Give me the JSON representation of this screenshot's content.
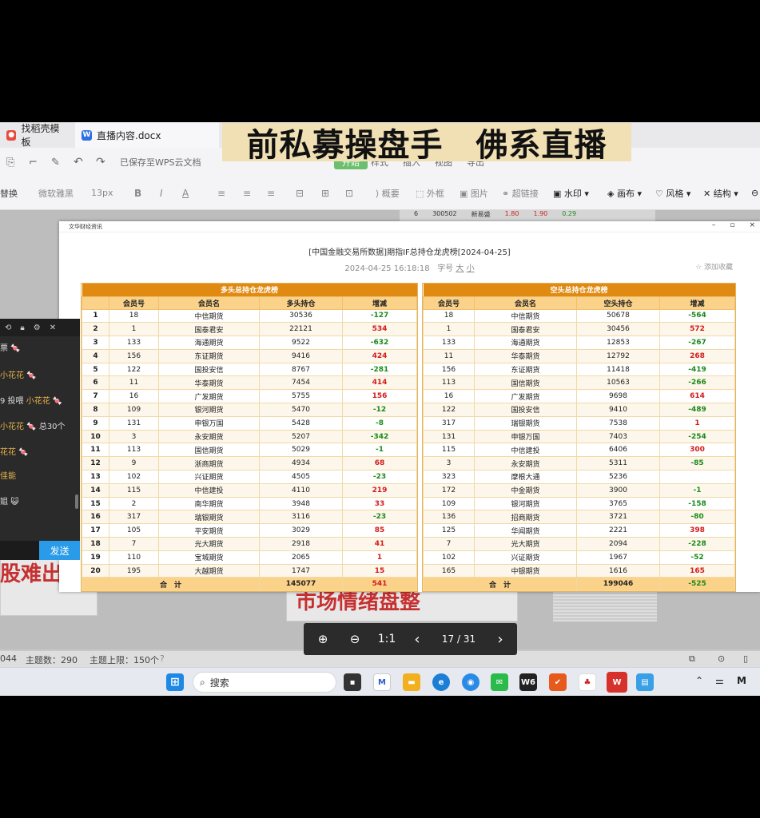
{
  "tabs": [
    {
      "label": "找稻壳模板",
      "icon": "docer-icon"
    },
    {
      "label": "直播内容.docx",
      "icon": "word-doc-icon"
    }
  ],
  "banner": "前私募操盘手　佛系直播",
  "toolbar": {
    "saved": "已保存至WPS云文档",
    "menu": [
      "样式",
      "插入",
      "视图",
      "导出"
    ],
    "replace": "替换",
    "font": "微软雅黑",
    "size": "13px",
    "items": [
      "概要",
      "外框",
      "图片",
      "超链接",
      "水印",
      "画布",
      "风格",
      "结构"
    ]
  },
  "stock_strip": [
    "6",
    "300502",
    "新易盛",
    "1.80",
    "1.90",
    "0.29"
  ],
  "window": {
    "title": "文华财经资讯",
    "ctrl_min": "–",
    "ctrl_max": "▫",
    "ctrl_close": "×",
    "heading": "[中国金融交易所数据]期指IF总持仓龙虎榜[2024-04-25]",
    "datetime": "2024-04-25 16:18:18",
    "font_label": "字号",
    "font_big": "大",
    "font_small": "小",
    "favorite": "☆ 添加收藏"
  },
  "long_table": {
    "caption": "多头总持仓龙虎榜",
    "headers": [
      "",
      "会员号",
      "会员名",
      "多头持仓",
      "增减"
    ],
    "rows": [
      [
        "1",
        "18",
        "中信期货",
        "30536",
        "-127"
      ],
      [
        "2",
        "1",
        "国泰君安",
        "22121",
        "534"
      ],
      [
        "3",
        "133",
        "海通期货",
        "9522",
        "-632"
      ],
      [
        "4",
        "156",
        "东证期货",
        "9416",
        "424"
      ],
      [
        "5",
        "122",
        "国投安信",
        "8767",
        "-281"
      ],
      [
        "6",
        "11",
        "华泰期货",
        "7454",
        "414"
      ],
      [
        "7",
        "16",
        "广发期货",
        "5755",
        "156"
      ],
      [
        "8",
        "109",
        "银河期货",
        "5470",
        "-12"
      ],
      [
        "9",
        "131",
        "申银万国",
        "5428",
        "-8"
      ],
      [
        "10",
        "3",
        "永安期货",
        "5207",
        "-342"
      ],
      [
        "11",
        "113",
        "国信期货",
        "5029",
        "-1"
      ],
      [
        "12",
        "9",
        "浙商期货",
        "4934",
        "68"
      ],
      [
        "13",
        "102",
        "兴证期货",
        "4505",
        "-23"
      ],
      [
        "14",
        "115",
        "中信建投",
        "4110",
        "219"
      ],
      [
        "15",
        "2",
        "南华期货",
        "3948",
        "33"
      ],
      [
        "16",
        "317",
        "瑞银期货",
        "3116",
        "-23"
      ],
      [
        "17",
        "105",
        "平安期货",
        "3029",
        "85"
      ],
      [
        "18",
        "7",
        "光大期货",
        "2918",
        "41"
      ],
      [
        "19",
        "110",
        "宝城期货",
        "2065",
        "1"
      ],
      [
        "20",
        "195",
        "大越期货",
        "1747",
        "15"
      ]
    ],
    "total_label": "合　计",
    "total_pos": "145077",
    "total_chg": "541"
  },
  "short_table": {
    "caption": "空头总持仓龙虎榜",
    "headers": [
      "会员号",
      "会员名",
      "空头持仓",
      "增减"
    ],
    "rows": [
      [
        "18",
        "中信期货",
        "50678",
        "-564"
      ],
      [
        "1",
        "国泰君安",
        "30456",
        "572"
      ],
      [
        "133",
        "海通期货",
        "12853",
        "-267"
      ],
      [
        "11",
        "华泰期货",
        "12792",
        "268"
      ],
      [
        "156",
        "东证期货",
        "11418",
        "-419"
      ],
      [
        "113",
        "国信期货",
        "10563",
        "-266"
      ],
      [
        "16",
        "广发期货",
        "9698",
        "614"
      ],
      [
        "122",
        "国投安信",
        "9410",
        "-489"
      ],
      [
        "317",
        "瑞银期货",
        "7538",
        "1"
      ],
      [
        "131",
        "申银万国",
        "7403",
        "-254"
      ],
      [
        "115",
        "中信建投",
        "6406",
        "300"
      ],
      [
        "3",
        "永安期货",
        "5311",
        "-85"
      ],
      [
        "323",
        "摩根大通",
        "5236",
        ""
      ],
      [
        "172",
        "中金期货",
        "3900",
        "-1"
      ],
      [
        "109",
        "银河期货",
        "3765",
        "-158"
      ],
      [
        "136",
        "招商期货",
        "3721",
        "-80"
      ],
      [
        "125",
        "华闻期货",
        "2221",
        "398"
      ],
      [
        "7",
        "光大期货",
        "2094",
        "-228"
      ],
      [
        "102",
        "兴证期货",
        "1967",
        "-52"
      ],
      [
        "165",
        "中银期货",
        "1616",
        "165"
      ]
    ],
    "total_label": "合　计",
    "total_pos": "199046",
    "total_chg": "-525"
  },
  "chat": {
    "messages": [
      {
        "pre": "票",
        "gold": "",
        "post": "🍬"
      },
      {
        "pre": "",
        "gold": "小花花",
        "post": "🍬"
      },
      {
        "pre": "9 投喂 ",
        "gold": "小花花",
        "post": "🍬"
      },
      {
        "pre": "",
        "gold": "小花花",
        "post": "🍬 总30个"
      },
      {
        "pre": "",
        "gold": "花花",
        "post": "🍬"
      },
      {
        "pre": "",
        "gold": "佳能",
        "post": ""
      },
      {
        "pre": "姐",
        "gold": "",
        "post": "😺"
      }
    ],
    "send": "发送"
  },
  "bg_text": [
    "股难出头",
    "市场情绪盘整"
  ],
  "viewer": {
    "page": "17 / 31",
    "ratio": "1:1"
  },
  "status": {
    "words": "044",
    "topics": "主题数：290",
    "limit": "主题上限：150个"
  },
  "taskbar": {
    "search": "搜索"
  }
}
